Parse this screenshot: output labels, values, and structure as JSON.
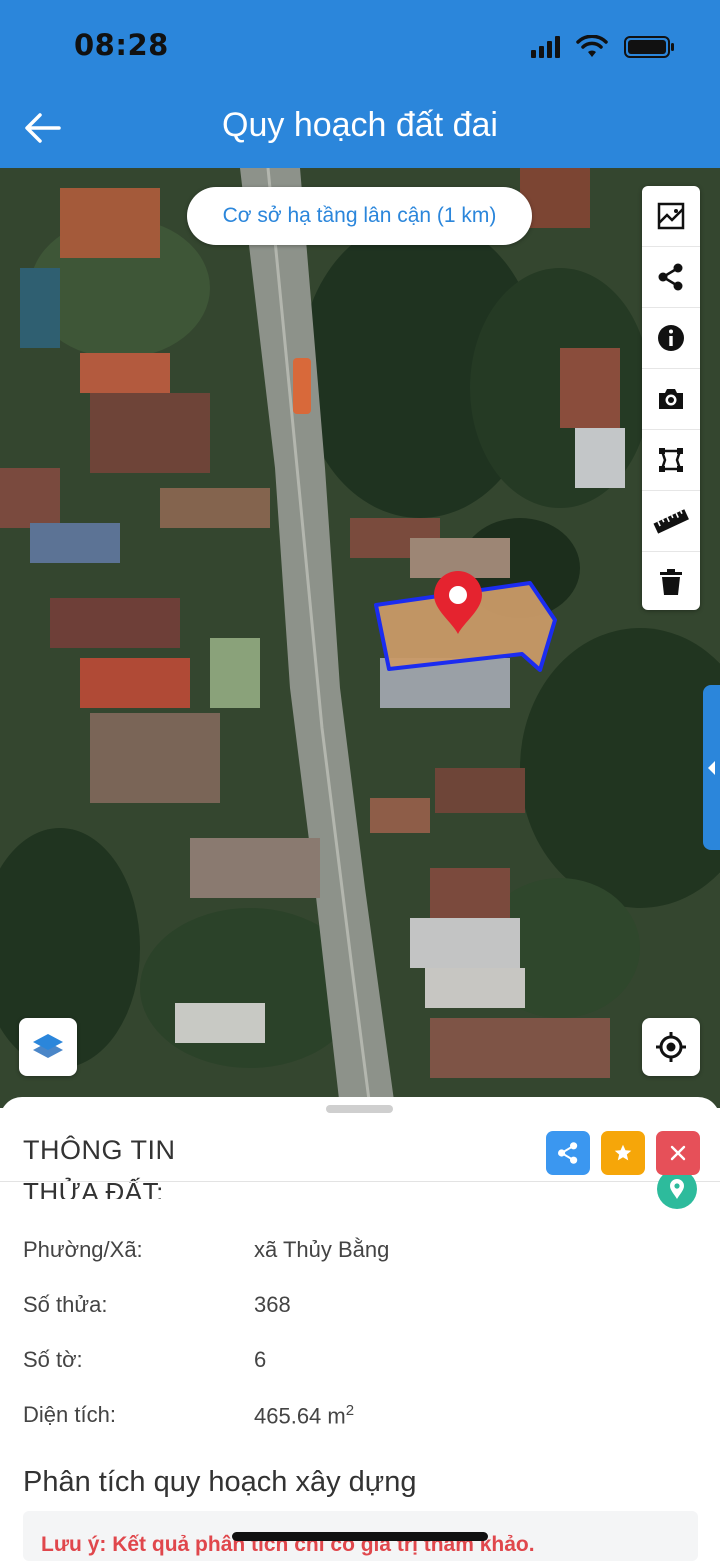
{
  "status_bar": {
    "time": "08:28"
  },
  "header": {
    "title": "Quy hoạch đất đai"
  },
  "map": {
    "nearby_button": "Cơ sở hạ tầng lân cận (1 km)",
    "toolbar": [
      "image-icon",
      "share-icon",
      "info-icon",
      "camera-icon",
      "polygon-icon",
      "ruler-icon",
      "trash-icon"
    ]
  },
  "sheet": {
    "heading": "THÔNG TIN",
    "parcel_label": "THỬA ĐẤT:",
    "rows": [
      {
        "label": "Phường/Xã:",
        "value": "xã Thủy Bằng"
      },
      {
        "label": "Số thửa:",
        "value": "368"
      },
      {
        "label": "Số tờ:",
        "value": "6"
      },
      {
        "label": "Diện tích:",
        "value": "465.64 m",
        "unit_sup": "2"
      }
    ],
    "analysis_heading": "Phân tích quy hoạch xây dựng",
    "note": "Lưu ý: Kết quả phân tích chỉ có giá trị tham khảo."
  },
  "colors": {
    "primary": "#2b86db",
    "favorite": "#f6a609",
    "close": "#e65059",
    "pin": "#e5232f",
    "parcel_fill": "#c99a67",
    "parcel_border": "#1b2cf0",
    "location_teal": "#2dbb9c",
    "note_red": "#e0474c"
  }
}
